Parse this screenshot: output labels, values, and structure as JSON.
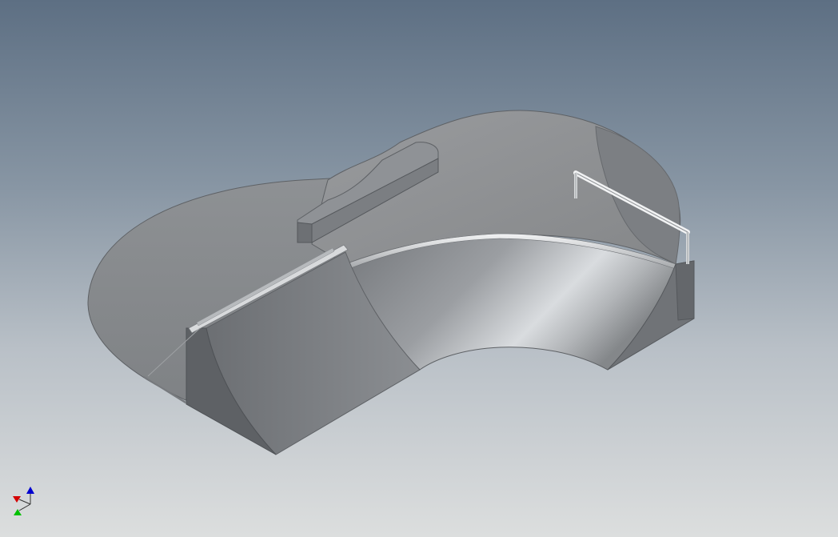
{
  "viewport": {
    "background_top": "#5d6f83",
    "background_bottom": "#dcdede",
    "model": {
      "kind": "skatepark bowl with quarter pipe ramp, ledge box and handrail",
      "parts": [
        "deck-floor",
        "upper-lobe",
        "left-lobe",
        "ledge-box",
        "quarter-pipe",
        "straight-ramp",
        "handrail"
      ],
      "surface_color": "#8a8d91",
      "edge_color": "#55585c"
    },
    "view_triad": {
      "x_color": "#d40000",
      "y_color": "#00c000",
      "z_color": "#0000d0",
      "icons": [
        "axis-x-icon",
        "axis-y-icon",
        "axis-z-icon"
      ]
    }
  }
}
